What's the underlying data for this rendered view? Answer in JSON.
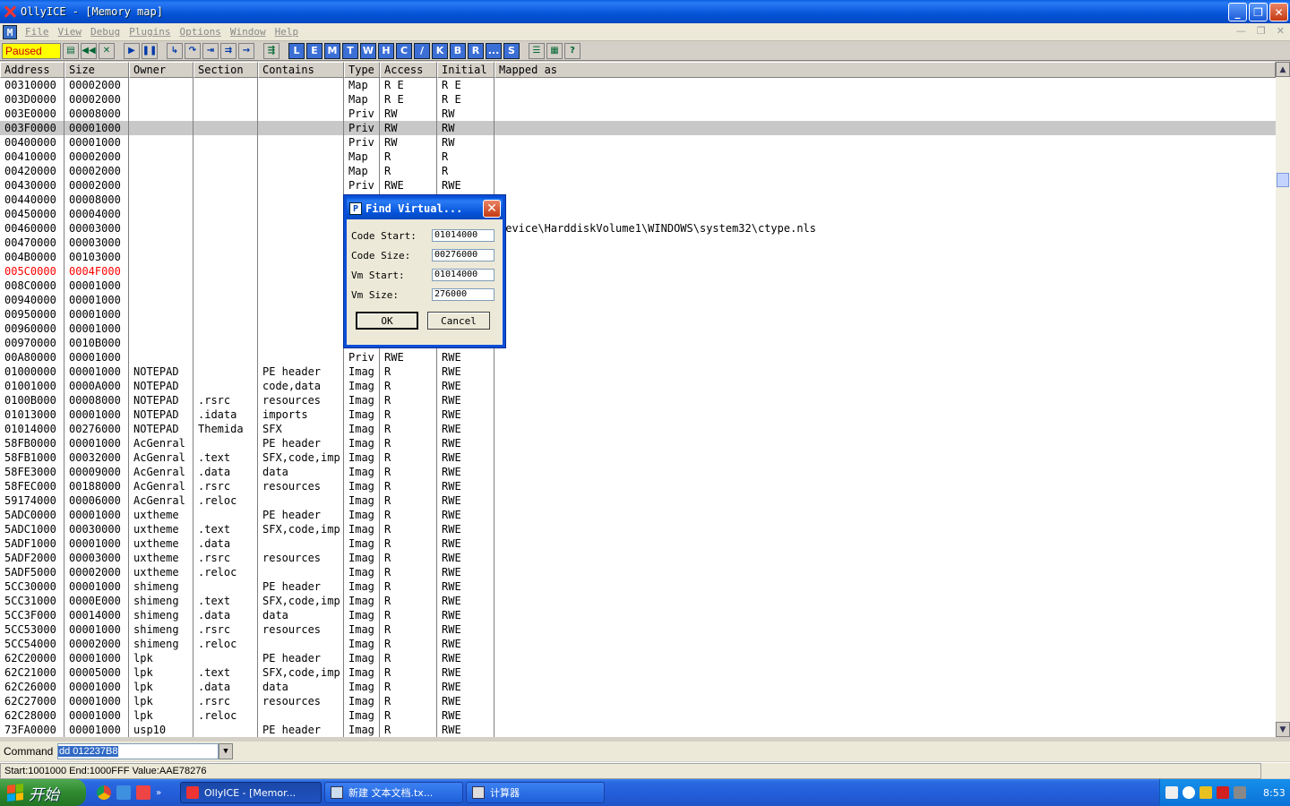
{
  "window": {
    "title": "OllyICE - [Memory map]"
  },
  "menu": [
    "File",
    "View",
    "Debug",
    "Plugins",
    "Options",
    "Window",
    "Help"
  ],
  "toolbar": {
    "status": "Paused",
    "letters": [
      "L",
      "E",
      "M",
      "T",
      "W",
      "H",
      "C",
      "/",
      "K",
      "B",
      "R",
      "...",
      "S"
    ]
  },
  "columns": [
    "Address",
    "Size",
    "Owner",
    "Section",
    "Contains",
    "Type",
    "Access",
    "Initial",
    "Mapped as"
  ],
  "rows": [
    [
      "00310000",
      "00002000",
      "",
      "",
      "",
      "Map",
      "R E",
      "R E",
      ""
    ],
    [
      "003D0000",
      "00002000",
      "",
      "",
      "",
      "Map",
      "R E",
      "R E",
      ""
    ],
    [
      "003E0000",
      "00008000",
      "",
      "",
      "",
      "Priv",
      "RW",
      "RW",
      ""
    ],
    [
      "003F0000",
      "00001000",
      "",
      "",
      "",
      "Priv",
      "RW",
      "RW",
      ""
    ],
    [
      "00400000",
      "00001000",
      "",
      "",
      "",
      "Priv",
      "RW",
      "RW",
      ""
    ],
    [
      "00410000",
      "00002000",
      "",
      "",
      "",
      "Map",
      "R",
      "R",
      ""
    ],
    [
      "00420000",
      "00002000",
      "",
      "",
      "",
      "Map",
      "R",
      "R",
      ""
    ],
    [
      "00430000",
      "00002000",
      "",
      "",
      "",
      "Priv",
      "RWE",
      "RWE",
      ""
    ],
    [
      "00440000",
      "00008000",
      "",
      "",
      "",
      "",
      "",
      "",
      ""
    ],
    [
      "00450000",
      "00004000",
      "",
      "",
      "",
      "",
      "",
      "",
      ""
    ],
    [
      "00460000",
      "00003000",
      "",
      "",
      "",
      "",
      "",
      "",
      "Device\\HarddiskVolume1\\WINDOWS\\system32\\ctype.nls"
    ],
    [
      "00470000",
      "00003000",
      "",
      "",
      "",
      "",
      "",
      "",
      ""
    ],
    [
      "004B0000",
      "00103000",
      "",
      "",
      "",
      "",
      "",
      "",
      ""
    ],
    [
      "005C0000",
      "0004F000",
      "",
      "",
      "",
      "",
      "",
      "",
      ""
    ],
    [
      "008C0000",
      "00001000",
      "",
      "",
      "",
      "",
      "",
      "",
      ""
    ],
    [
      "00940000",
      "00001000",
      "",
      "",
      "",
      "",
      "",
      "",
      ""
    ],
    [
      "00950000",
      "00001000",
      "",
      "",
      "",
      "",
      "",
      "",
      ""
    ],
    [
      "00960000",
      "00001000",
      "",
      "",
      "",
      "",
      "",
      "",
      ""
    ],
    [
      "00970000",
      "0010B000",
      "",
      "",
      "",
      "",
      "",
      "",
      ""
    ],
    [
      "00A80000",
      "00001000",
      "",
      "",
      "",
      "Priv",
      "RWE",
      "RWE",
      ""
    ],
    [
      "01000000",
      "00001000",
      "NOTEPAD",
      "",
      "PE header",
      "Imag",
      "R",
      "RWE",
      ""
    ],
    [
      "01001000",
      "0000A000",
      "NOTEPAD",
      "",
      "code,data",
      "Imag",
      "R",
      "RWE",
      ""
    ],
    [
      "0100B000",
      "00008000",
      "NOTEPAD",
      ".rsrc",
      "resources",
      "Imag",
      "R",
      "RWE",
      ""
    ],
    [
      "01013000",
      "00001000",
      "NOTEPAD",
      ".idata",
      "imports",
      "Imag",
      "R",
      "RWE",
      ""
    ],
    [
      "01014000",
      "00276000",
      "NOTEPAD",
      "Themida",
      "SFX",
      "Imag",
      "R",
      "RWE",
      ""
    ],
    [
      "58FB0000",
      "00001000",
      "AcGenral",
      "",
      "PE header",
      "Imag",
      "R",
      "RWE",
      ""
    ],
    [
      "58FB1000",
      "00032000",
      "AcGenral",
      ".text",
      "SFX,code,imp",
      "Imag",
      "R",
      "RWE",
      ""
    ],
    [
      "58FE3000",
      "00009000",
      "AcGenral",
      ".data",
      "data",
      "Imag",
      "R",
      "RWE",
      ""
    ],
    [
      "58FEC000",
      "00188000",
      "AcGenral",
      ".rsrc",
      "resources",
      "Imag",
      "R",
      "RWE",
      ""
    ],
    [
      "59174000",
      "00006000",
      "AcGenral",
      ".reloc",
      "",
      "Imag",
      "R",
      "RWE",
      ""
    ],
    [
      "5ADC0000",
      "00001000",
      "uxtheme",
      "",
      "PE header",
      "Imag",
      "R",
      "RWE",
      ""
    ],
    [
      "5ADC1000",
      "00030000",
      "uxtheme",
      ".text",
      "SFX,code,imp",
      "Imag",
      "R",
      "RWE",
      ""
    ],
    [
      "5ADF1000",
      "00001000",
      "uxtheme",
      ".data",
      "",
      "Imag",
      "R",
      "RWE",
      ""
    ],
    [
      "5ADF2000",
      "00003000",
      "uxtheme",
      ".rsrc",
      "resources",
      "Imag",
      "R",
      "RWE",
      ""
    ],
    [
      "5ADF5000",
      "00002000",
      "uxtheme",
      ".reloc",
      "",
      "Imag",
      "R",
      "RWE",
      ""
    ],
    [
      "5CC30000",
      "00001000",
      "shimeng",
      "",
      "PE header",
      "Imag",
      "R",
      "RWE",
      ""
    ],
    [
      "5CC31000",
      "0000E000",
      "shimeng",
      ".text",
      "SFX,code,imp",
      "Imag",
      "R",
      "RWE",
      ""
    ],
    [
      "5CC3F000",
      "00014000",
      "shimeng",
      ".data",
      "data",
      "Imag",
      "R",
      "RWE",
      ""
    ],
    [
      "5CC53000",
      "00001000",
      "shimeng",
      ".rsrc",
      "resources",
      "Imag",
      "R",
      "RWE",
      ""
    ],
    [
      "5CC54000",
      "00002000",
      "shimeng",
      ".reloc",
      "",
      "Imag",
      "R",
      "RWE",
      ""
    ],
    [
      "62C20000",
      "00001000",
      "lpk",
      "",
      "PE header",
      "Imag",
      "R",
      "RWE",
      ""
    ],
    [
      "62C21000",
      "00005000",
      "lpk",
      ".text",
      "SFX,code,imp",
      "Imag",
      "R",
      "RWE",
      ""
    ],
    [
      "62C26000",
      "00001000",
      "lpk",
      ".data",
      "data",
      "Imag",
      "R",
      "RWE",
      ""
    ],
    [
      "62C27000",
      "00001000",
      "lpk",
      ".rsrc",
      "resources",
      "Imag",
      "R",
      "RWE",
      ""
    ],
    [
      "62C28000",
      "00001000",
      "lpk",
      ".reloc",
      "",
      "Imag",
      "R",
      "RWE",
      ""
    ],
    [
      "73FA0000",
      "00001000",
      "usp10",
      "",
      "PE header",
      "Imag",
      "R",
      "RWE",
      ""
    ]
  ],
  "selected_row": 3,
  "highlight_row": 13,
  "dialog": {
    "title": "Find Virtual...",
    "fields": [
      {
        "label": "Code Start:",
        "value": "01014000"
      },
      {
        "label": "Code Size:",
        "value": "00276000"
      },
      {
        "label": "Vm Start:",
        "value": "01014000"
      },
      {
        "label": "Vm Size:",
        "value": "276000"
      }
    ],
    "ok": "OK",
    "cancel": "Cancel"
  },
  "command": {
    "label": "Command",
    "value": "dd 012237B8"
  },
  "status_line": "Start:1001000 End:1000FFF Value:AAE78276",
  "taskbar": {
    "start": "开始",
    "tasks": [
      "OllyICE - [Memor...",
      "新建 文本文档.tx...",
      "计算器"
    ],
    "clock": "8:53"
  }
}
